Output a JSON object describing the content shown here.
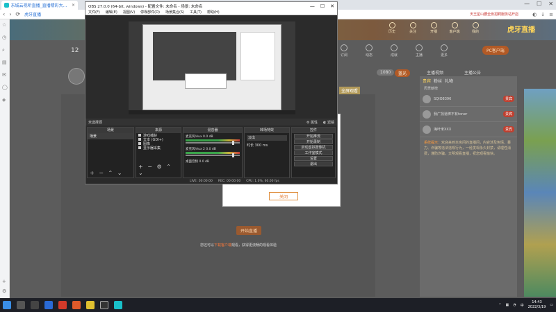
{
  "browser": {
    "tab_title": "东城云视听直播_直播精彩大剧播_",
    "tab_close": "×",
    "win_controls": [
      "—",
      "☐",
      "✕"
    ],
    "url": "虎牙直播",
    "news": "天王星山腰全身招聘服务站开店",
    "back": "‹",
    "forward": "›",
    "refresh": "⟳"
  },
  "page": {
    "brand": "虎牙直播",
    "top_icons": [
      "历史",
      "关注",
      "开播",
      "客户端",
      "我的"
    ],
    "toolbar2": [
      "订阅",
      "动态",
      "成就",
      "主播",
      "更多"
    ],
    "user_count": "12",
    "pc_live_btn": "PC客户端",
    "pills": [
      "1080",
      "蓝光",
      "主播视频",
      "主播公告"
    ],
    "tag_gold": "全屏观看",
    "rank_tabs": [
      "贵宾",
      "粉丝",
      "礼物"
    ],
    "rank_sub": "周贡献榜",
    "rank_rows": [
      {
        "name": "SQIO8396",
        "badge": "贵宾"
      },
      {
        "name": "我广找道棒不有toner",
        "badge": "贵宾"
      },
      {
        "name": "海叶米XXX",
        "badge": "贵宾"
      }
    ],
    "notice_label": "系统提示：",
    "notice_text": "欢迎来到本房间的直播间，内容涉及色情、暴力、诈骗等违法违规行为，一经发现永久封禁，请理性消费，谨防诈骗，文明观看直播，祝您观看愉快。",
    "dialog_btn": "关闭",
    "open_btn": "开始直播",
    "tip_pre": "您还可以",
    "tip_link": "下载客户端",
    "tip_post": "观看，获得更流畅的观看体验"
  },
  "obs": {
    "title": "OBS 27.0.0 (64-bit, windows) - 配置文件: 未命名 - 场景: 未命名",
    "menus": [
      "文件(F)",
      "编辑(E)",
      "视图(V)",
      "停靠部件(D)",
      "场景集合(S)",
      "工具(T)",
      "帮助(H)"
    ],
    "scene_bar_label": "未选择源",
    "scene_bar_props": "属性",
    "scene_bar_filters": "滤镜",
    "docks": {
      "scenes": {
        "title": "场景",
        "items": [
          "场景"
        ]
      },
      "sources": {
        "title": "来源",
        "items": [
          "游戏捕获",
          "文本 (GDI+)",
          "图像",
          "显示器采集"
        ]
      },
      "mixer": {
        "title": "混音器",
        "tracks": [
          {
            "name": "麦克风/Aux",
            "db": "0.0 dB"
          },
          {
            "name": "麦克风/Aux 2",
            "db": "0.0 dB"
          },
          {
            "name": "桌面音频",
            "db": "0.0 dB"
          }
        ]
      },
      "transitions": {
        "title": "转场特效",
        "selected": "淡出",
        "duration_label": "时长",
        "duration": "300 ms"
      },
      "controls": {
        "title": "控件",
        "buttons": [
          "开始推流",
          "开始录制",
          "启动虚拟摄像机",
          "工作室模式",
          "设置",
          "退出"
        ]
      }
    },
    "status": [
      "LIVE: 00:00:00",
      "REC: 00:00:00",
      "CPU: 1.0%, 60.00 fps"
    ],
    "tools": "+ − ⌃ ⌄"
  },
  "taskbar": {
    "time": "14:43",
    "date": "2022/3/19",
    "tray_lang": "中"
  }
}
